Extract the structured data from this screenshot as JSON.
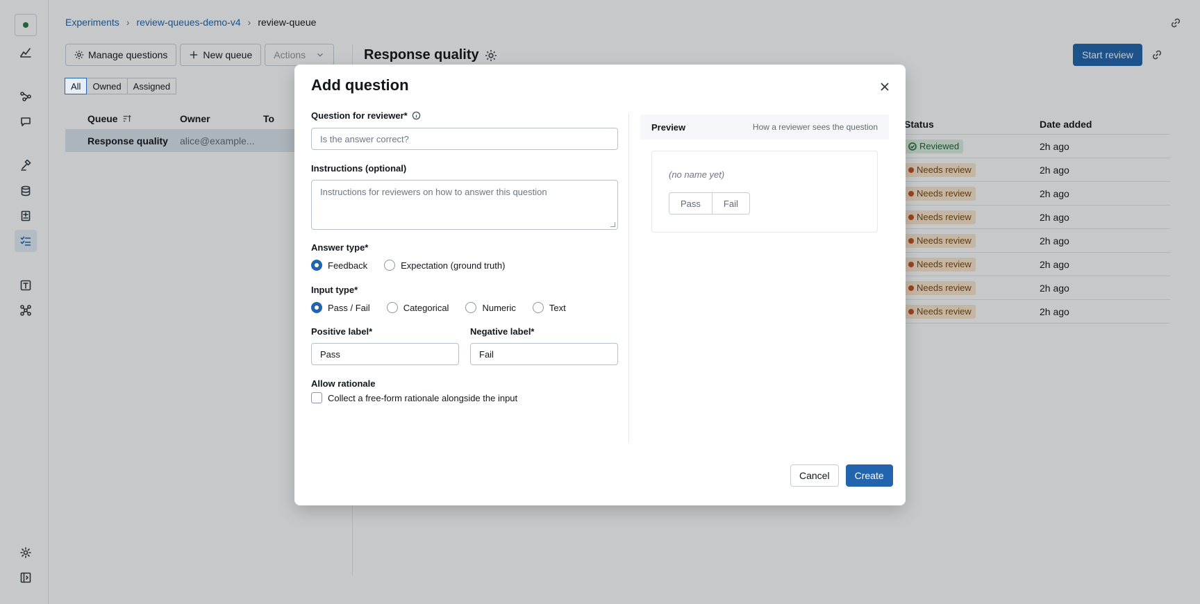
{
  "breadcrumb": {
    "items": [
      "Experiments",
      "review-queues-demo-v4",
      "review-queue"
    ],
    "separator": "›"
  },
  "toolbar": {
    "manage_questions": "Manage questions",
    "new_queue": "New queue",
    "actions": "Actions"
  },
  "filter": {
    "options": [
      "All",
      "Owned",
      "Assigned"
    ],
    "selected": "All"
  },
  "queues_table": {
    "columns": [
      "Queue",
      "Owner",
      "To"
    ],
    "rows": [
      {
        "queue": "Response quality",
        "owner": "alice@example..."
      }
    ]
  },
  "queue_detail": {
    "title": "Response quality",
    "start_review": "Start review",
    "columns": [
      "Status",
      "Date added"
    ],
    "rows": [
      {
        "status": "Reviewed",
        "date": "2h ago"
      },
      {
        "status": "Needs review",
        "date": "2h ago"
      },
      {
        "status": "Needs review",
        "date": "2h ago"
      },
      {
        "status": "Needs review",
        "date": "2h ago"
      },
      {
        "status": "Needs review",
        "date": "2h ago"
      },
      {
        "status": "Needs review",
        "date": "2h ago"
      },
      {
        "status": "Needs review",
        "date": "2h ago"
      },
      {
        "status": "Needs review",
        "date": "2h ago"
      }
    ]
  },
  "modal": {
    "title": "Add question",
    "question_label": "Question for reviewer*",
    "question_placeholder": "Is the answer correct?",
    "instructions_label": "Instructions (optional)",
    "instructions_placeholder": "Instructions for reviewers on how to answer this question",
    "answer_type_label": "Answer type*",
    "answer_types": [
      "Feedback",
      "Expectation (ground truth)"
    ],
    "answer_type_selected": "Feedback",
    "input_type_label": "Input type*",
    "input_types": [
      "Pass / Fail",
      "Categorical",
      "Numeric",
      "Text"
    ],
    "input_type_selected": "Pass / Fail",
    "positive_label": "Positive label*",
    "positive_value": "Pass",
    "negative_label": "Negative label*",
    "negative_value": "Fail",
    "rationale_label": "Allow rationale",
    "rationale_checkbox": "Collect a free-form rationale alongside the input",
    "rationale_checked": false,
    "preview": {
      "title": "Preview",
      "subtitle": "How a reviewer sees the question",
      "name_placeholder": "(no name yet)",
      "buttons": [
        "Pass",
        "Fail"
      ]
    },
    "cancel": "Cancel",
    "create": "Create"
  },
  "colors": {
    "accent": "#2264ae",
    "reviewed_bg": "#dff0e1",
    "needs_review_bg": "#fbe8cf",
    "needs_review_dot": "#c8501f"
  },
  "icons": [
    "logo-icon",
    "chart-icon",
    "flow-icon",
    "chat-icon",
    "gavel-icon",
    "database-icon",
    "scorecard-icon",
    "checklist-icon",
    "text-icon",
    "network-icon",
    "gear-icon",
    "sidebar-collapse-icon",
    "link-icon",
    "close-icon",
    "info-icon",
    "plus-icon",
    "sort-icon",
    "chevron-down-icon"
  ]
}
